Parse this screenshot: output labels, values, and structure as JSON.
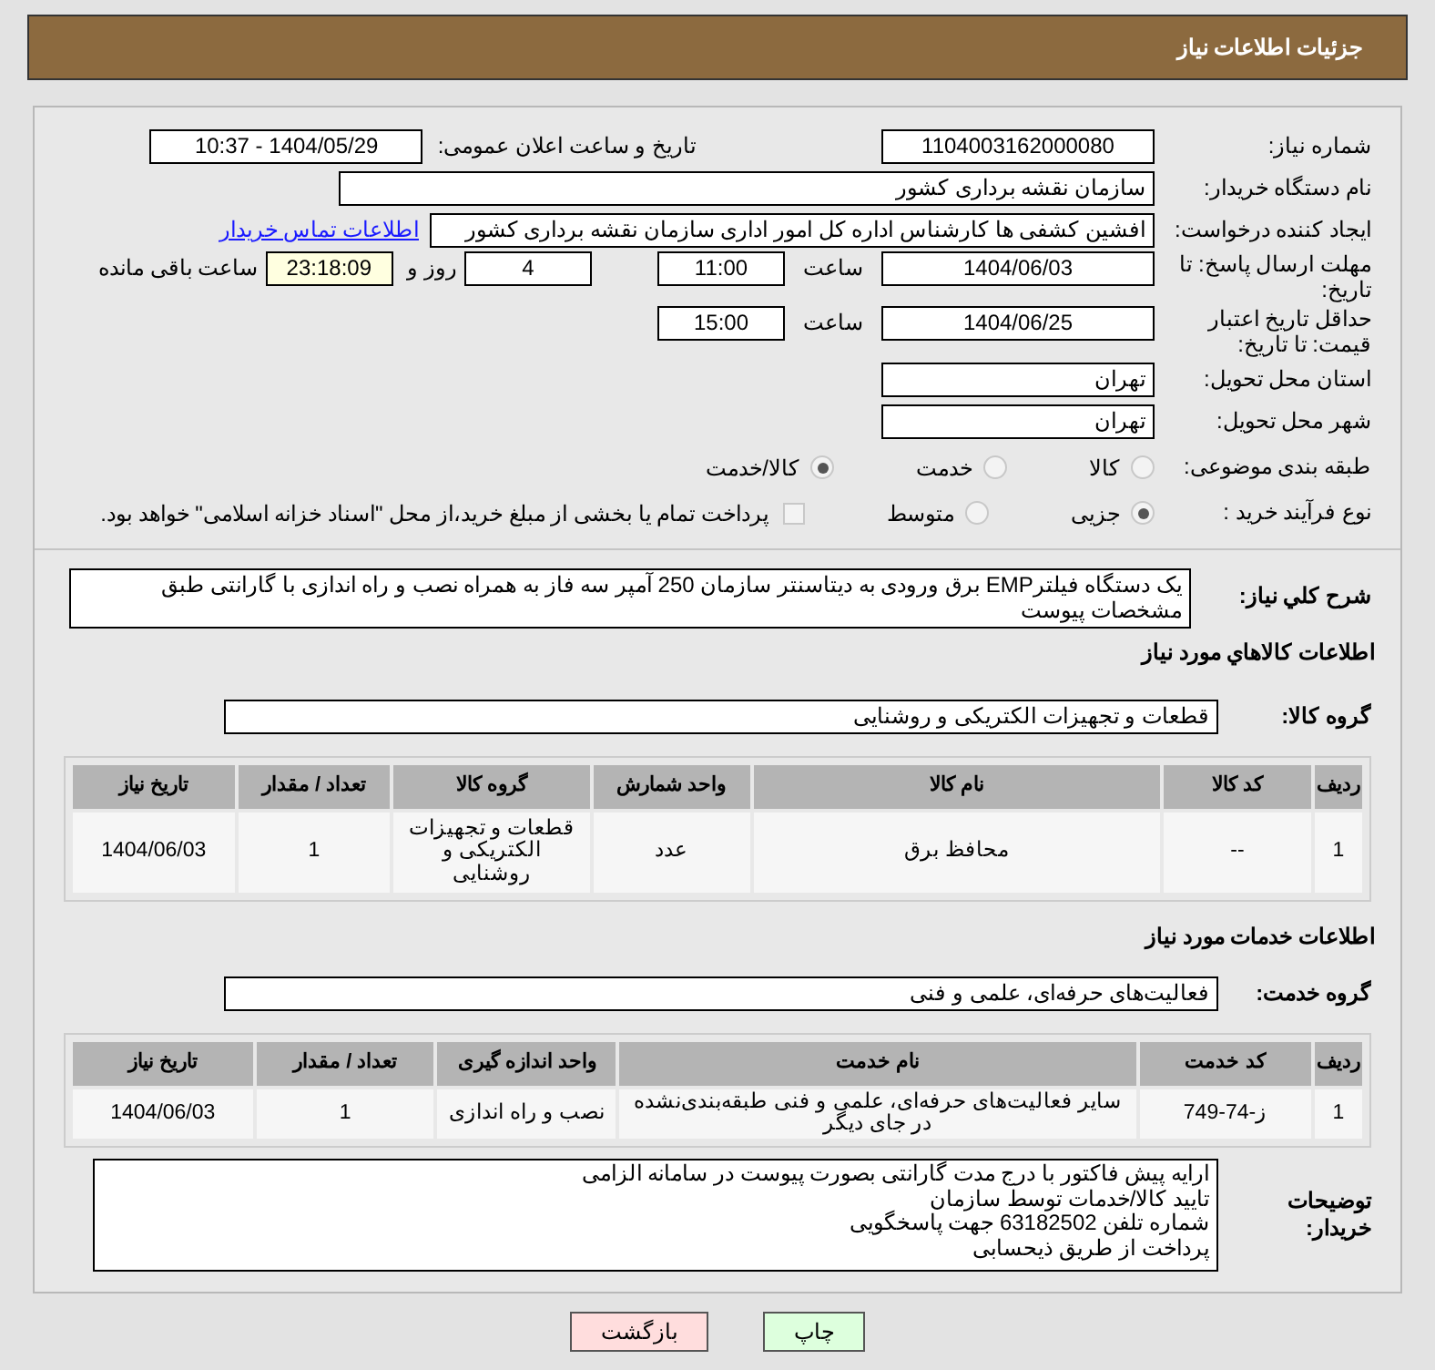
{
  "header": {
    "title": "جزئیات اطلاعات نیاز"
  },
  "need_number": {
    "label": "شماره نیاز:",
    "value": "1104003162000080"
  },
  "announce": {
    "label": "تاریخ و ساعت اعلان عمومی:",
    "value": "1404/05/29 - 10:37"
  },
  "buyer_org": {
    "label": "نام دستگاه خریدار:",
    "value": "سازمان نقشه برداری کشور"
  },
  "requester": {
    "label": "ایجاد کننده درخواست:",
    "value": "افشین کشفی ها کارشناس اداره کل امور اداری سازمان نقشه برداری کشور",
    "link": "اطلاعات تماس خریدار"
  },
  "deadline": {
    "label": "مهلت ارسال پاسخ: تا تاریخ:",
    "date": "1404/06/03",
    "time_label": "ساعت",
    "time": "11:00",
    "days": "4",
    "days_label": "روز و",
    "remaining": "23:18:09",
    "remaining_label": "ساعت باقی مانده"
  },
  "validity": {
    "label": "حداقل تاریخ اعتبار قیمت: تا تاریخ:",
    "date": "1404/06/25",
    "time_label": "ساعت",
    "time": "15:00"
  },
  "province": {
    "label": "استان محل تحویل:",
    "value": "تهران"
  },
  "city": {
    "label": "شهر محل تحویل:",
    "value": "تهران"
  },
  "category": {
    "label": "طبقه بندی موضوعی:",
    "options": [
      {
        "label": "کالا",
        "selected": false
      },
      {
        "label": "خدمت",
        "selected": false
      },
      {
        "label": "کالا/خدمت",
        "selected": true
      }
    ]
  },
  "process": {
    "label": "نوع فرآیند خرید :",
    "options": [
      {
        "label": "جزیی",
        "selected": true
      },
      {
        "label": "متوسط",
        "selected": false
      }
    ],
    "payment_note": {
      "label": "پرداخت تمام یا بخشی از مبلغ خرید،از محل \"اسناد خزانه اسلامی\" خواهد بود.",
      "checked": false
    }
  },
  "summary": {
    "label": "شرح کلي نیاز:",
    "value": "یک دستگاه فیلترEMP  برق ورودی به دیتاسنتر سازمان 250 آمپر سه فاز به همراه نصب و راه اندازی با گارانتی طبق مشخصات پیوست"
  },
  "goods": {
    "title": "اطلاعات کالاهاي مورد نیاز",
    "group_label": "گروه کالا:",
    "group": "قطعات و تجهیزات الکتریکی و روشنایی",
    "columns": [
      "ردیف",
      "کد کالا",
      "نام کالا",
      "واحد شمارش",
      "گروه کالا",
      "تعداد / مقدار",
      "تاریخ نیاز"
    ],
    "rows": [
      [
        "1",
        "--",
        "محافظ برق",
        "عدد",
        "قطعات و تجهیزات الکتریکی و روشنایی",
        "1",
        "1404/06/03"
      ]
    ]
  },
  "services": {
    "title": "اطلاعات خدمات مورد نیاز",
    "group_label": "گروه خدمت:",
    "group": "فعالیت‌های حرفه‌ای، علمی و فنی",
    "columns": [
      "ردیف",
      "کد خدمت",
      "نام خدمت",
      "واحد اندازه گیری",
      "تعداد / مقدار",
      "تاریخ نیاز"
    ],
    "rows": [
      [
        "1",
        "ز-74-749",
        "سایر فعالیت‌های حرفه‌ای، علمی و فنی طبقه‌بندی‌نشده در جای دیگر",
        "نصب و راه اندازی",
        "1",
        "1404/06/03"
      ]
    ]
  },
  "buyer_notes": {
    "label": "توضیحات خریدار:",
    "lines": [
      "ارایه پیش فاکتور با درج مدت گارانتی بصورت پیوست در سامانه الزامی",
      "تایید کالا/خدمات  توسط سازمان",
      "شماره تلفن 63182502 جهت پاسخگویی",
      "پرداخت از طریق ذیحسابی"
    ]
  },
  "buttons": [
    {
      "label": "چاپ",
      "kind": "print"
    },
    {
      "label": "بازگشت",
      "kind": "back"
    }
  ]
}
